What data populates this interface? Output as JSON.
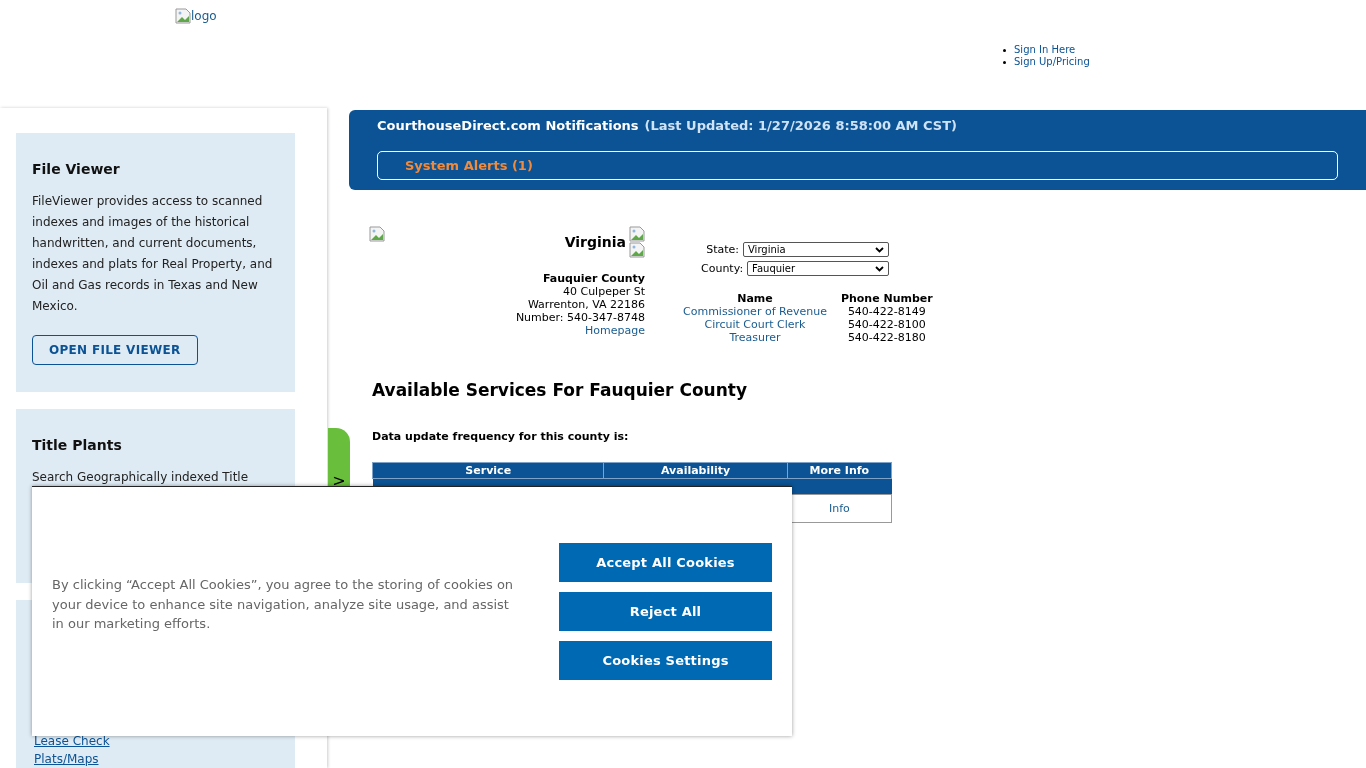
{
  "header": {
    "logo_alt": "logo",
    "account_links": [
      "Sign In Here",
      "Sign Up/Pricing"
    ]
  },
  "sidebar": {
    "toggle": ">",
    "cards": [
      {
        "title": "File Viewer",
        "text": "FileViewer provides access to scanned indexes and images of the historical handwritten, and current documents, indexes and plats for Real Property, and Oil and Gas records in Texas and New Mexico.",
        "button": "OPEN FILE VIEWER"
      },
      {
        "title": "Title Plants",
        "text": "Search Geographically indexed Title"
      },
      {
        "links": [
          "Lease Check",
          "Plats/Maps"
        ]
      }
    ]
  },
  "notifications": {
    "title": "CourthouseDirect.com Notifications",
    "updated": "(Last Updated: 1/27/2026 8:58:00 AM CST)",
    "alert": "System Alerts (1)"
  },
  "county": {
    "state_name": "Virginia",
    "name": "Fauquier County",
    "address": [
      "40 Culpeper St",
      "Warrenton, VA 22186"
    ],
    "number": "Number: 540-347-8748",
    "homepage": "Homepage",
    "state_label": "State:",
    "state_value": "Virginia",
    "county_label": "County:",
    "county_value": "Fauquier",
    "contacts_columns": [
      "Name",
      "Phone Number"
    ],
    "contacts": [
      {
        "name": "Commissioner of Revenue",
        "phone": "540-422-8149"
      },
      {
        "name": "Circuit Court Clerk",
        "phone": "540-422-8100"
      },
      {
        "name": "Treasurer",
        "phone": "540-422-8180"
      }
    ]
  },
  "services": {
    "heading": "Available Services For Fauquier County",
    "frequency": "Data update frequency for this county is:",
    "columns": [
      "Service",
      "Availability",
      "More Info"
    ],
    "rows": [
      {
        "more_info": "Info"
      }
    ]
  },
  "cookie_banner": {
    "text": "By clicking “Accept All Cookies”, you agree to the storing of cookies on your device to enhance site navigation, analyze site usage, and assist in our marketing efforts.",
    "buttons": [
      "Accept All Cookies",
      "Reject All",
      "Cookies Settings"
    ]
  }
}
